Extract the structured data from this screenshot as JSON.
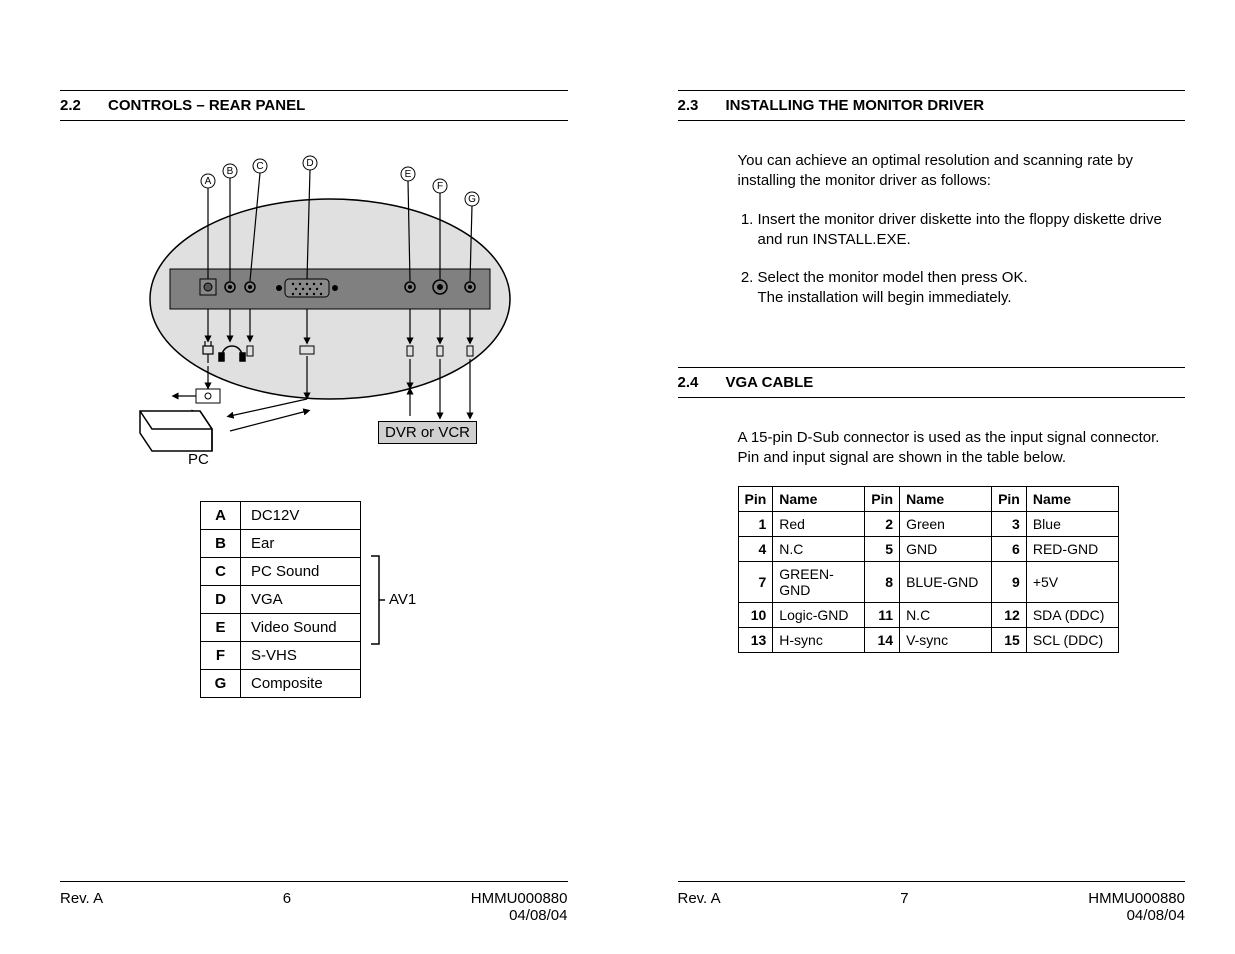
{
  "left": {
    "section_num": "2.2",
    "section_title": "CONTROLS – REAR PANEL",
    "diagram": {
      "callouts": [
        "A",
        "B",
        "C",
        "D",
        "E",
        "F",
        "G"
      ],
      "pc_label": "PC",
      "dvr_label": "DVR or VCR"
    },
    "legend": [
      {
        "key": "A",
        "val": "DC12V"
      },
      {
        "key": "B",
        "val": "Ear"
      },
      {
        "key": "C",
        "val": "PC Sound"
      },
      {
        "key": "D",
        "val": "VGA"
      },
      {
        "key": "E",
        "val": "Video Sound"
      },
      {
        "key": "F",
        "val": "S-VHS"
      },
      {
        "key": "G",
        "val": "Composite"
      }
    ],
    "av1_label": "AV1",
    "footer": {
      "rev": "Rev. A",
      "page": "6",
      "doc": "HMMU000880",
      "date": "04/08/04"
    }
  },
  "right": {
    "sec23_num": "2.3",
    "sec23_title": "INSTALLING THE MONITOR DRIVER",
    "sec23_intro": "You can achieve an optimal resolution and scanning rate by installing the monitor driver as follows:",
    "sec23_steps": [
      "Insert the monitor driver diskette into the floppy diskette drive and run INSTALL.EXE.",
      "Select the monitor model then press OK.\nThe installation will begin immediately."
    ],
    "sec24_num": "2.4",
    "sec24_title": "VGA CABLE",
    "sec24_intro": "A 15-pin D-Sub connector is used as the input signal connector. Pin and input signal are shown in the table below.",
    "pin_headers": [
      "Pin",
      "Name",
      "Pin",
      "Name",
      "Pin",
      "Name"
    ],
    "pins": [
      [
        "1",
        "Red",
        "2",
        "Green",
        "3",
        "Blue"
      ],
      [
        "4",
        "N.C",
        "5",
        "GND",
        "6",
        "RED-GND"
      ],
      [
        "7",
        "GREEN-GND",
        "8",
        "BLUE-GND",
        "9",
        "+5V"
      ],
      [
        "10",
        "Logic-GND",
        "11",
        "N.C",
        "12",
        "SDA (DDC)"
      ],
      [
        "13",
        "H-sync",
        "14",
        "V-sync",
        "15",
        "SCL (DDC)"
      ]
    ],
    "footer": {
      "rev": "Rev. A",
      "page": "7",
      "doc": "HMMU000880",
      "date": "04/08/04"
    }
  }
}
